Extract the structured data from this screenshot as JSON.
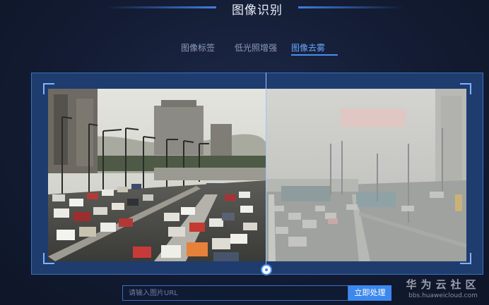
{
  "header": {
    "title": "图像识别"
  },
  "tabs": [
    {
      "label": "图像标签",
      "active": false
    },
    {
      "label": "低光照增强",
      "active": false
    },
    {
      "label": "图像去雾",
      "active": true
    }
  ],
  "viewer": {
    "left_image": "dehazed-traffic-photo",
    "right_image": "hazy-traffic-photo",
    "billboard_text": ""
  },
  "url_form": {
    "placeholder": "请输入图片URL",
    "value": "",
    "button_label": "立即处理"
  },
  "watermark": {
    "brand": "华为云社区",
    "url": "bbs.huaweicloud.com"
  },
  "colors": {
    "accent": "#3d88ee",
    "active_tab": "#6aa8ff",
    "frame": "#1f3c6e"
  }
}
